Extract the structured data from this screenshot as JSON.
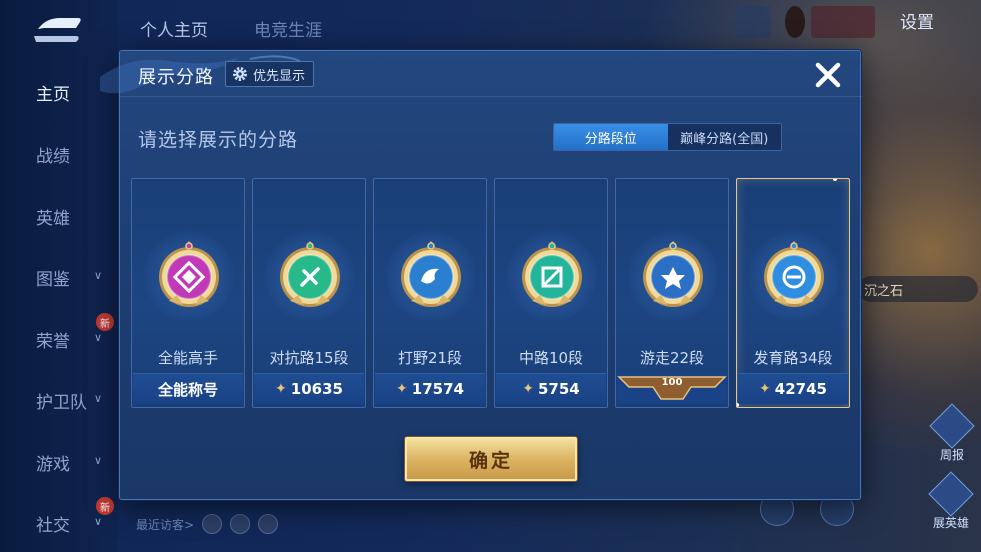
{
  "background": {
    "top_tabs": [
      "个人主页",
      "电竞生涯"
    ],
    "sidebar_items": [
      {
        "label": "主页",
        "active": true,
        "chevron": false,
        "new": false
      },
      {
        "label": "战绩",
        "active": false,
        "chevron": false,
        "new": false
      },
      {
        "label": "英雄",
        "active": false,
        "chevron": false,
        "new": false
      },
      {
        "label": "图鉴",
        "active": false,
        "chevron": true,
        "new": false
      },
      {
        "label": "荣誉",
        "active": false,
        "chevron": true,
        "new": true
      },
      {
        "label": "护卫队",
        "active": false,
        "chevron": true,
        "new": false
      },
      {
        "label": "游戏",
        "active": false,
        "chevron": true,
        "new": false
      },
      {
        "label": "社交",
        "active": false,
        "chevron": true,
        "new": true
      }
    ],
    "new_badge": "新",
    "settings_label": "设置",
    "recent_visitors_label": "最近访客>",
    "stone_label": "沉之石",
    "right_buttons": [
      "周报",
      "展英雄"
    ]
  },
  "modal": {
    "title": "展示分路",
    "priority_label": "优先显示",
    "prompt": "请选择展示的分路",
    "segment": {
      "active": "分路段位",
      "inactive": "巅峰分路(全国)"
    },
    "confirm_label": "确定",
    "cards": [
      {
        "name": "全能高手",
        "footer": "全能称号",
        "score": null,
        "selected": false,
        "badge_color": "#c03ab8",
        "icon": "allround-icon"
      },
      {
        "name": "对抗路15段",
        "footer": null,
        "score": "10635",
        "selected": false,
        "badge_color": "#27b98a",
        "icon": "clash-lane-icon"
      },
      {
        "name": "打野21段",
        "footer": null,
        "score": "17574",
        "selected": false,
        "badge_color": "#2a7fd0",
        "icon": "jungle-icon"
      },
      {
        "name": "中路10段",
        "footer": null,
        "score": "5754",
        "selected": false,
        "badge_color": "#22b59a",
        "icon": "mid-lane-icon"
      },
      {
        "name": "游走22段",
        "footer": null,
        "score": null,
        "ribbon_value": "100",
        "selected": false,
        "badge_color": "#2b6fc6",
        "icon": "roam-icon"
      },
      {
        "name": "发育路34段",
        "footer": null,
        "score": "42745",
        "selected": true,
        "badge_color": "#2f8ee0",
        "icon": "farm-lane-icon"
      }
    ]
  }
}
